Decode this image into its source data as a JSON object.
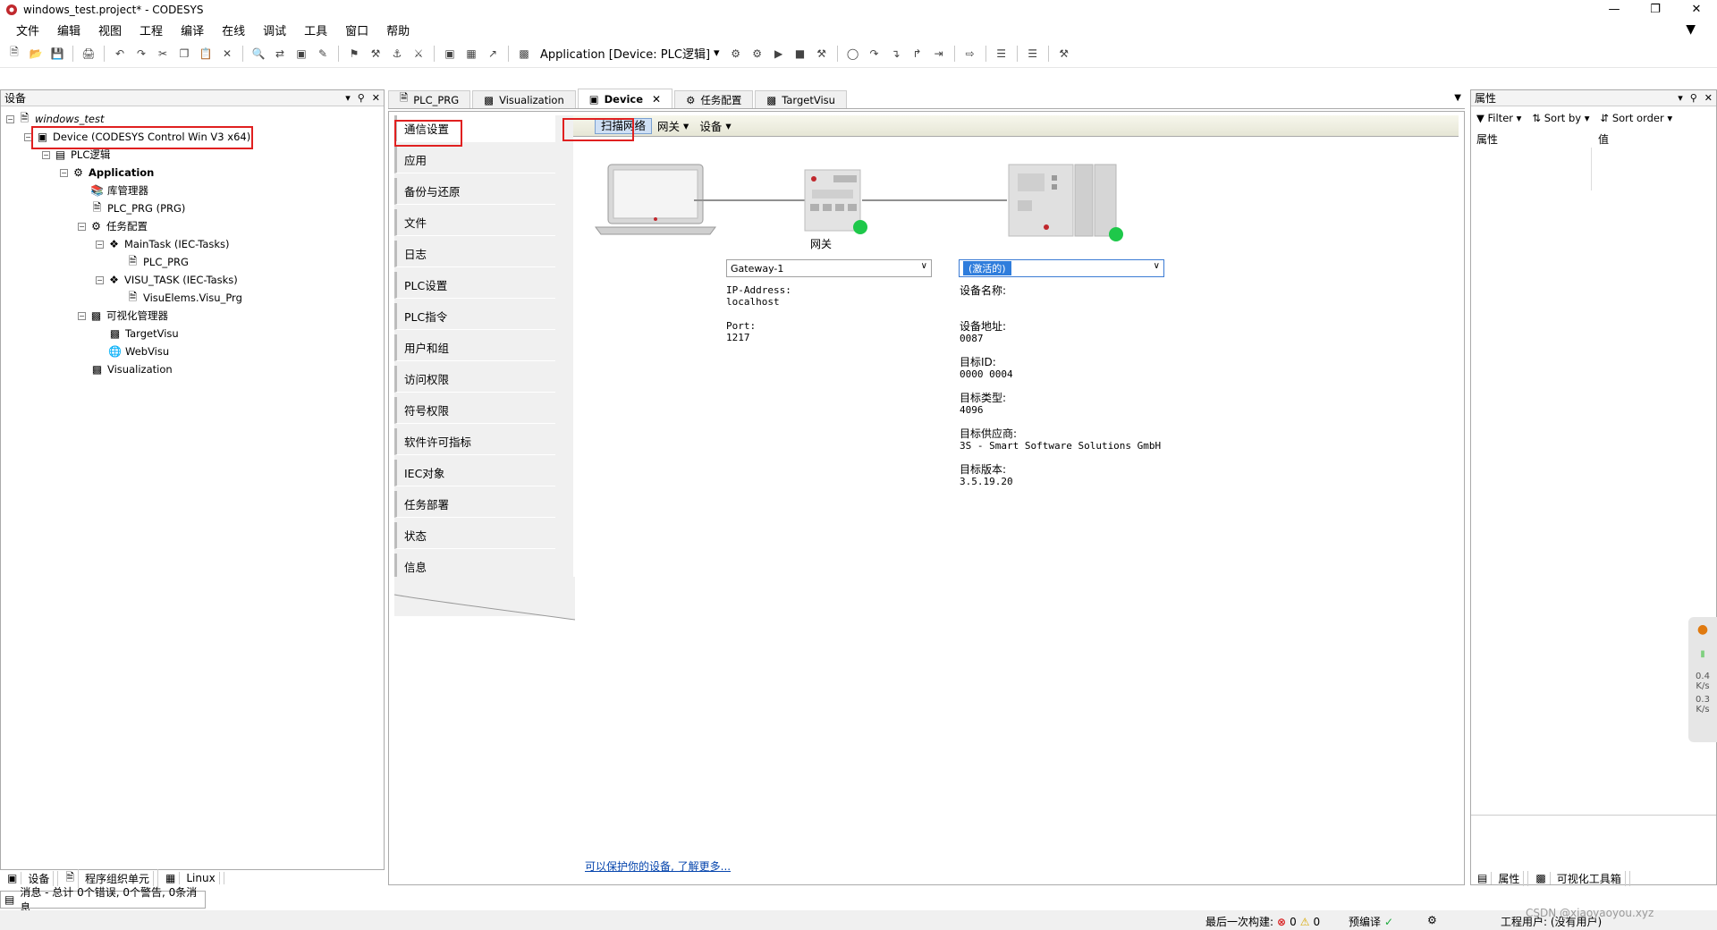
{
  "window": {
    "title": "windows_test.project* - CODESYS",
    "controls": [
      "—",
      "❐",
      "✕"
    ]
  },
  "menu": [
    "文件",
    "编辑",
    "视图",
    "工程",
    "编译",
    "在线",
    "调试",
    "工具",
    "窗口",
    "帮助"
  ],
  "toolbar": {
    "app_selector": "Application [Device: PLC逻辑]"
  },
  "devices_panel": {
    "title": "设备",
    "tree": {
      "root": "windows_test",
      "device": "Device (CODESYS Control Win V3 x64)",
      "plc_logic": "PLC逻辑",
      "application": "Application",
      "library_manager": "库管理器",
      "plc_prg": "PLC_PRG (PRG)",
      "task_config": "任务配置",
      "main_task": "MainTask (IEC-Tasks)",
      "main_task_prg": "PLC_PRG",
      "visu_task": "VISU_TASK (IEC-Tasks)",
      "visu_task_prg": "VisuElems.Visu_Prg",
      "visu_manager": "可视化管理器",
      "target_visu": "TargetVisu",
      "web_visu": "WebVisu",
      "visualization": "Visualization"
    },
    "bottom_tabs": [
      "设备",
      "程序组织单元",
      "Linux"
    ]
  },
  "messages_bar": "消息 - 总计 0个错误, 0个警告, 0条消息",
  "editor_tabs": [
    {
      "label": "PLC_PRG",
      "active": false
    },
    {
      "label": "Visualization",
      "active": false
    },
    {
      "label": "Device",
      "active": true
    },
    {
      "label": "任务配置",
      "active": false
    },
    {
      "label": "TargetVisu",
      "active": false
    }
  ],
  "device_editor": {
    "nav_items": [
      "通信设置",
      "应用",
      "备份与还原",
      "文件",
      "日志",
      "PLC设置",
      "PLC指令",
      "用户和组",
      "访问权限",
      "符号权限",
      "软件许可指标",
      "IEC对象",
      "任务部署",
      "状态",
      "信息"
    ],
    "subtoolbar": {
      "scan_network": "扫描网络",
      "gateway": "网关",
      "device": "设备"
    },
    "gateway_label": "网关",
    "gateway_select": "Gateway-1",
    "device_select": "(激活的)",
    "gateway_info": {
      "ip_label": "IP-Address:",
      "ip_value": "localhost",
      "port_label": "Port:",
      "port_value": "1217"
    },
    "device_info": {
      "name_label": "设备名称:",
      "address_label": "设备地址:",
      "address_value": "0087",
      "target_id_label": "目标ID:",
      "target_id_value": "0000 0004",
      "target_type_label": "目标类型:",
      "target_type_value": "4096",
      "vendor_label": "目标供应商:",
      "vendor_value": "3S - Smart Software Solutions GmbH",
      "version_label": "目标版本:",
      "version_value": "3.5.19.20"
    },
    "protect_link": "可以保护你的设备, 了解更多..."
  },
  "properties_panel": {
    "title": "属性",
    "filter": "Filter",
    "sort_by": "Sort by",
    "sort_order": "Sort order",
    "col_property": "属性",
    "col_value": "值",
    "bottom_tabs": [
      "属性",
      "可视化工具箱"
    ]
  },
  "float_widget": {
    "up": "0.4",
    "up_unit": "K/s",
    "down": "0.3",
    "down_unit": "K/s"
  },
  "status_bar": {
    "last_build": "最后一次构建:",
    "errors": "0",
    "warnings": "0",
    "precompile": "预编译",
    "project_user": "工程用户: (没有用户)",
    "watermark": "CSDN @xiaoyaoyou.xyz"
  },
  "colors": {
    "highlight_red": "#e02020",
    "status_green": "#1ec84a",
    "link_blue": "#0645ad",
    "select_blue": "#2f7ddc"
  }
}
